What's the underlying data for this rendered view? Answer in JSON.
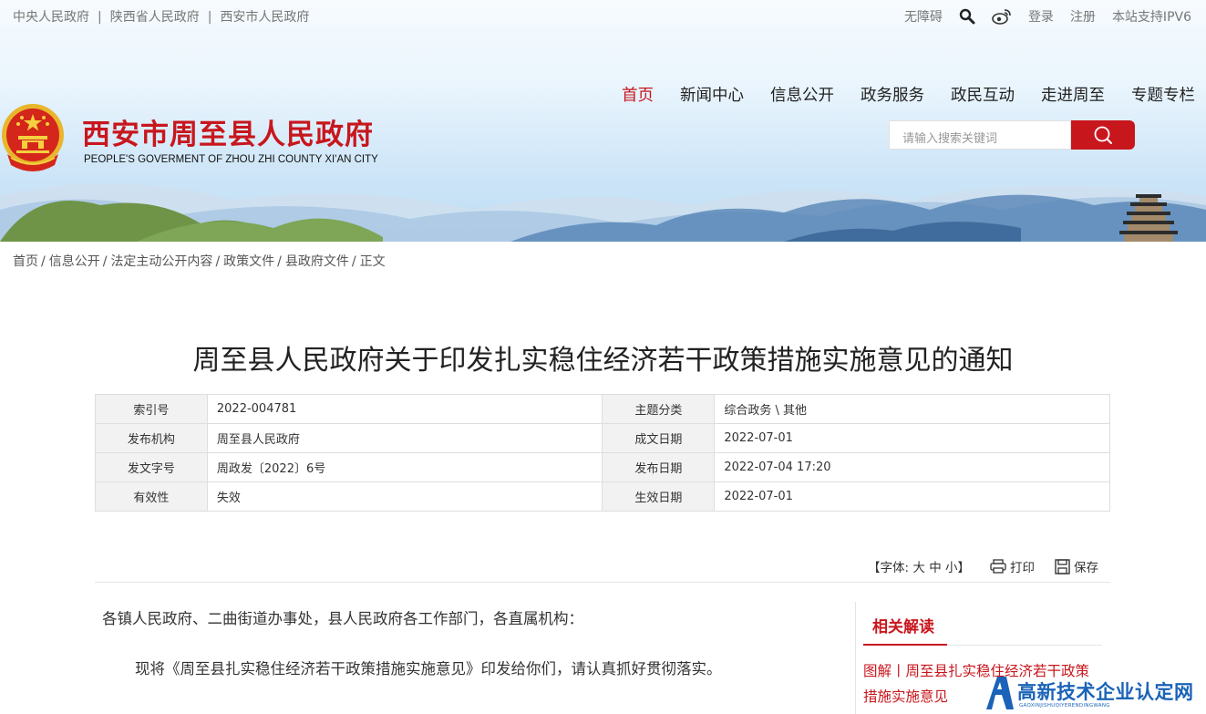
{
  "top_links": [
    "中央人民政府",
    "陕西省人民政府",
    "西安市人民政府"
  ],
  "top_right": {
    "accessibility": "无障碍",
    "login": "登录",
    "register": "注册",
    "ipv6": "本站支持IPV6"
  },
  "site": {
    "title": "西安市周至县人民政府",
    "subtitle": "PEOPLE'S GOVERMENT OF ZHOU ZHI COUNTY XI'AN CITY"
  },
  "nav": [
    "首页",
    "新闻中心",
    "信息公开",
    "政务服务",
    "政民互动",
    "走进周至",
    "专题专栏"
  ],
  "search": {
    "placeholder": "请输入搜索关键词"
  },
  "breadcrumb": [
    "首页",
    "信息公开",
    "法定主动公开内容",
    "政策文件",
    "县政府文件",
    "正文"
  ],
  "doc_title": "周至县人民政府关于印发扎实稳住经济若干政策措施实施意见的通知",
  "info_rows": [
    {
      "k1": "索引号",
      "v1": "2022-004781",
      "k2": "主题分类",
      "v2": "综合政务 \\ 其他"
    },
    {
      "k1": "发布机构",
      "v1": "周至县人民政府",
      "k2": "成文日期",
      "v2": "2022-07-01"
    },
    {
      "k1": "发文字号",
      "v1": "周政发〔2022〕6号",
      "k2": "发布日期",
      "v2": "2022-07-04 17:20"
    },
    {
      "k1": "有效性",
      "v1": "失效",
      "k2": "生效日期",
      "v2": "2022-07-01"
    }
  ],
  "tools": {
    "font_label": "【字体:",
    "big": "大",
    "mid": "中",
    "small": "小",
    "font_end": "】",
    "print": "打印",
    "save": "保存"
  },
  "body": {
    "para1": "各镇人民政府、二曲街道办事处，县人民政府各工作部门，各直属机构：",
    "para2": "现将《周至县扎实稳住经济若干政策措施实施意见》印发给你们，请认真抓好贯彻落实。"
  },
  "side": {
    "title": "相关解读",
    "link": "图解丨周至县扎实稳住经济若干政策措施实施意见"
  },
  "watermark": {
    "title": "高新技术企业认定网",
    "pinyin": "GAOXINJISHUQIYERENDINGWANG"
  },
  "colors": {
    "brand_red": "#c8161d",
    "watermark_blue": "#1b63b8"
  }
}
